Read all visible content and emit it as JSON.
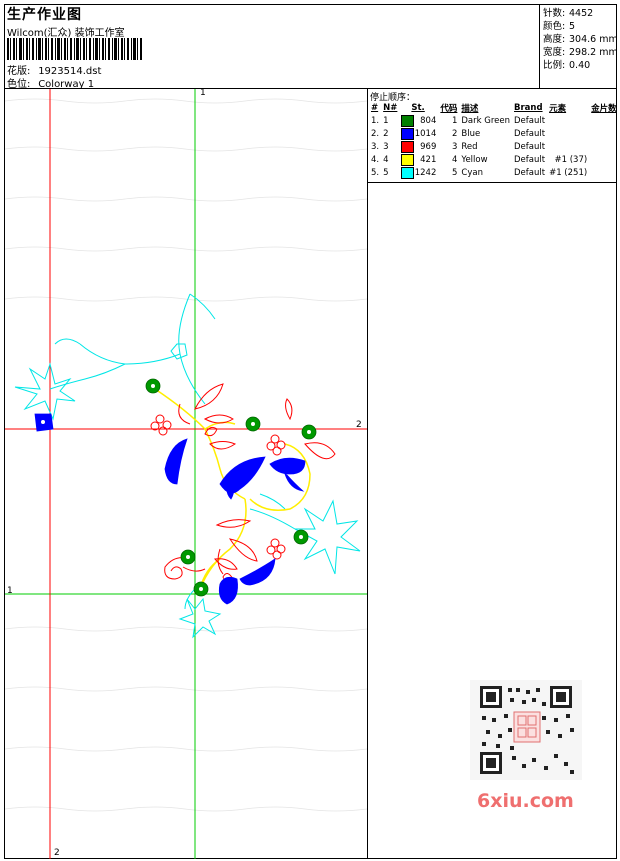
{
  "header": {
    "title": "生产作业图",
    "company": "Wilcom(汇众) 装饰工作室",
    "design_label": "花版:",
    "design_value": "1923514.dst",
    "colorway_label": "色位:",
    "colorway_value": "Colorway 1"
  },
  "specs": [
    {
      "label": "针数:",
      "value": "4452"
    },
    {
      "label": "颜色:",
      "value": "5"
    },
    {
      "label": "高度:",
      "value": "304.6 mm"
    },
    {
      "label": "宽度:",
      "value": "298.2 mm"
    },
    {
      "label": "比例:",
      "value": "0.40"
    }
  ],
  "sequence": {
    "title": "停止顺序：",
    "headers": [
      "#",
      "N#",
      "St.",
      "代码",
      "描述",
      "Brand",
      "元素",
      "金片数"
    ],
    "rows": [
      {
        "num": "1.",
        "n": "1",
        "color": "#008000",
        "st": "804",
        "code": "1",
        "desc": "Dark Green",
        "brand": "Default",
        "elem": "",
        "seq": ""
      },
      {
        "num": "2.",
        "n": "2",
        "color": "#0000ff",
        "st": "1014",
        "code": "2",
        "desc": "Blue",
        "brand": "Default",
        "elem": "",
        "seq": ""
      },
      {
        "num": "3.",
        "n": "3",
        "color": "#ff0000",
        "st": "969",
        "code": "3",
        "desc": "Red",
        "brand": "Default",
        "elem": "",
        "seq": ""
      },
      {
        "num": "4.",
        "n": "4",
        "color": "#ffff00",
        "st": "421",
        "code": "4",
        "desc": "Yellow",
        "brand": "Default",
        "elem": "#1 (37)",
        "seq": ""
      },
      {
        "num": "5.",
        "n": "5",
        "color": "#00ffff",
        "st": "1242",
        "code": "5",
        "desc": "Cyan",
        "brand": "Default",
        "elem": "#1 (251)",
        "seq": ""
      }
    ]
  },
  "axes": {
    "top": "1",
    "right": "2",
    "left": "1",
    "bottom": "2"
  },
  "watermark": "6xiu.com",
  "colors": {
    "green_axis": "#00cc00",
    "red_axis": "#ff0000",
    "cyan": "#00ffff",
    "blue": "#0000ff",
    "red": "#ff0000",
    "green": "#008000",
    "yellow": "#ffff00"
  }
}
